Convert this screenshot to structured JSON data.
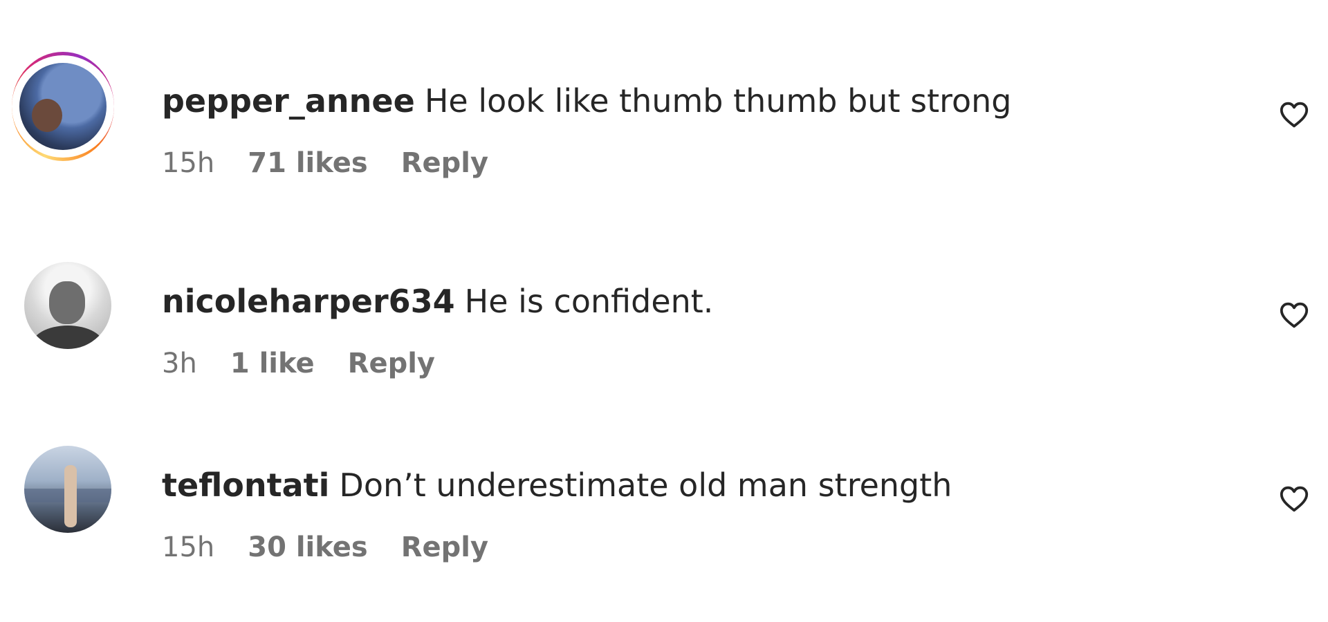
{
  "comments": [
    {
      "username": "pepper_annee",
      "text": "He look like thumb thumb but strong",
      "time": "15h",
      "likes": "71 likes",
      "reply_label": "Reply",
      "has_story_ring": true,
      "like_icon": "heart-outline-icon"
    },
    {
      "username": "nicoleharper634",
      "text": "He is confident.",
      "time": "3h",
      "likes": "1 like",
      "reply_label": "Reply",
      "has_story_ring": false,
      "like_icon": "heart-outline-icon"
    },
    {
      "username": "teflontati",
      "text": "Don’t underestimate old man strength",
      "time": "15h",
      "likes": "30 likes",
      "reply_label": "Reply",
      "has_story_ring": false,
      "like_icon": "heart-outline-icon"
    }
  ],
  "colors": {
    "text_primary": "#262626",
    "text_secondary": "#737373",
    "background": "#ffffff"
  }
}
